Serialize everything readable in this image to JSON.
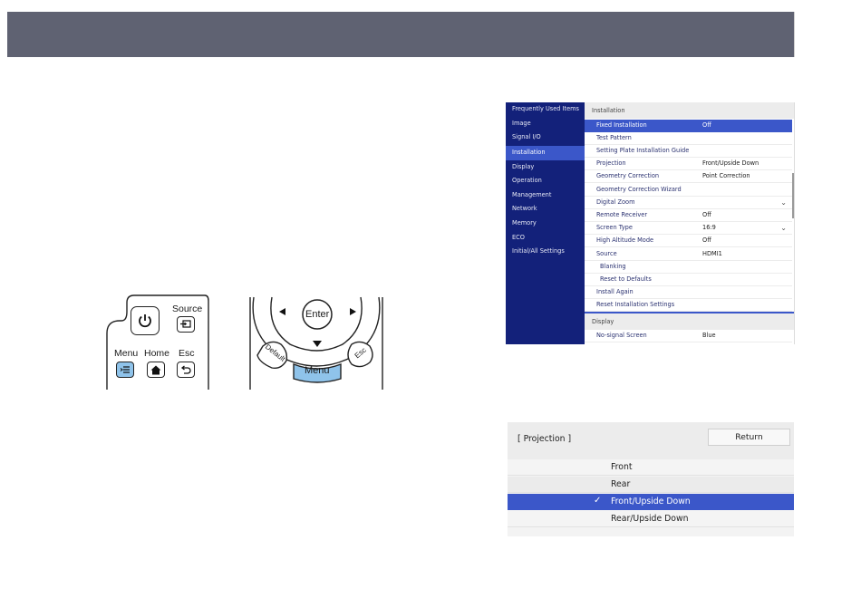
{
  "remote": {
    "source_label": "Source",
    "menu_label": "Menu",
    "home_label": "Home",
    "esc_label": "Esc",
    "enter_label": "Enter",
    "default_label": "Default",
    "menu_button_label": "Menu",
    "esc_button_label": "Esc"
  },
  "menu": {
    "sidebar": [
      {
        "label": "Frequently Used Items",
        "active": false
      },
      {
        "label": "Image",
        "active": false
      },
      {
        "label": "Signal I/O",
        "active": false
      },
      {
        "label": "Installation",
        "active": true
      },
      {
        "label": "Display",
        "active": false
      },
      {
        "label": "Operation",
        "active": false
      },
      {
        "label": "Management",
        "active": false
      },
      {
        "label": "Network",
        "active": false
      },
      {
        "label": "Memory",
        "active": false
      },
      {
        "label": "ECO",
        "active": false
      },
      {
        "label": "Initial/All Settings",
        "active": false
      }
    ],
    "section_installation": "Installation",
    "rows": [
      {
        "label": "Fixed Installation",
        "value": "Off"
      },
      {
        "label": "Test Pattern",
        "value": ""
      },
      {
        "label": "Setting Plate Installation Guide",
        "value": ""
      },
      {
        "label": "Projection",
        "value": "Front/Upside Down"
      },
      {
        "label": "Geometry Correction",
        "value": "Point Correction"
      },
      {
        "label": "Geometry Correction Wizard",
        "value": ""
      },
      {
        "label": "Digital Zoom",
        "value": ""
      },
      {
        "label": "Remote Receiver",
        "value": "Off"
      },
      {
        "label": "Screen Type",
        "value": "16:9"
      },
      {
        "label": "High Altitude Mode",
        "value": "Off"
      },
      {
        "label": "Source",
        "value": "HDMI1"
      },
      {
        "label": "Blanking",
        "value": ""
      },
      {
        "label": "Reset to Defaults",
        "value": ""
      },
      {
        "label": "Install Again",
        "value": ""
      },
      {
        "label": "Reset Installation Settings",
        "value": ""
      }
    ],
    "section_display": "Display",
    "display_rows": [
      {
        "label": "No-signal Screen",
        "value": "Blue"
      }
    ]
  },
  "dialog": {
    "title": "[ Projection ]",
    "return_label": "Return",
    "options": [
      {
        "label": "Front",
        "selected": false
      },
      {
        "label": "Rear",
        "selected": false
      },
      {
        "label": "Front/Upside Down",
        "selected": true
      },
      {
        "label": "Rear/Upside Down",
        "selected": false
      }
    ]
  }
}
